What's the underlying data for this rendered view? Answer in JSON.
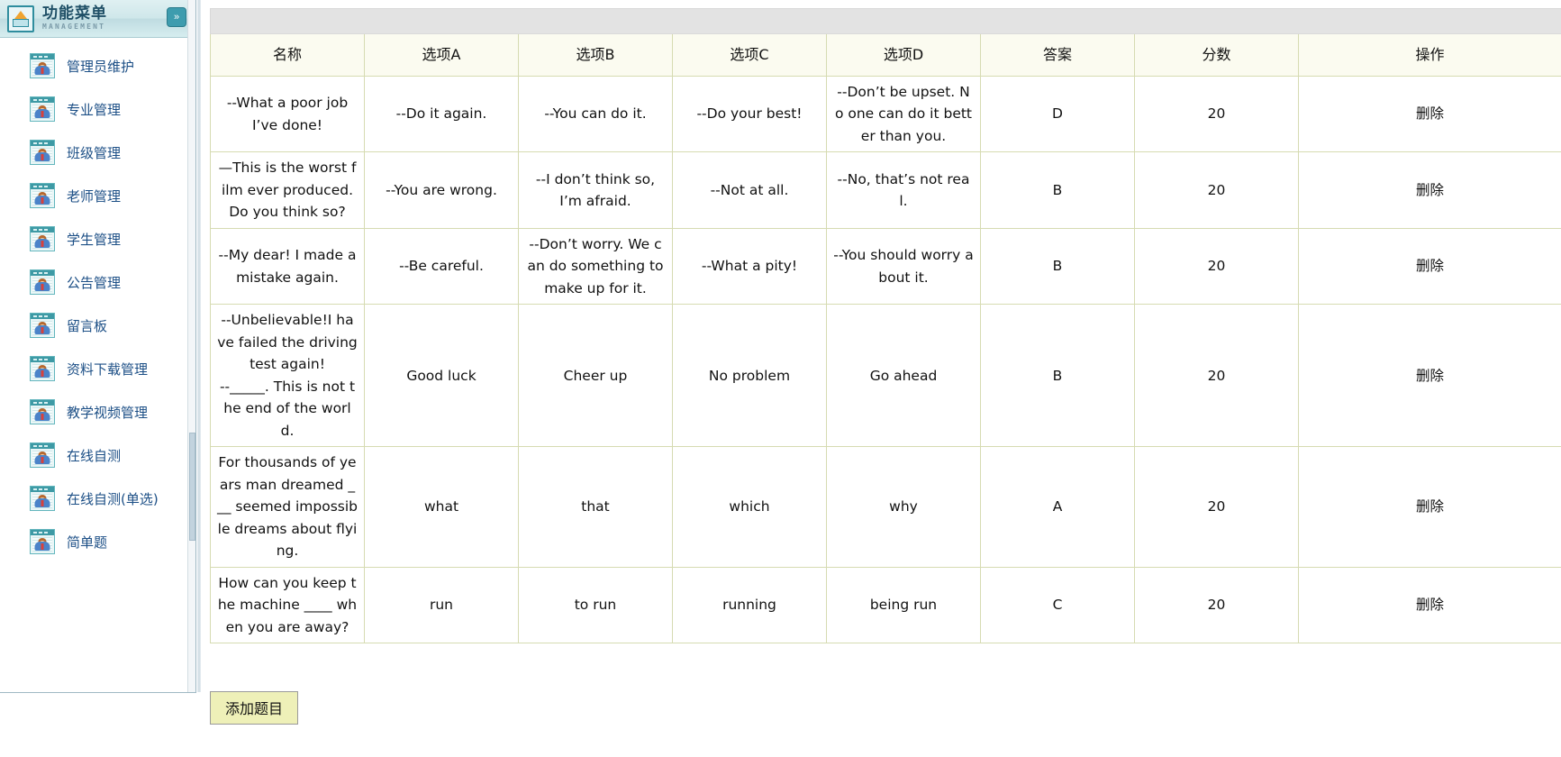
{
  "sidebar": {
    "title": "功能菜单",
    "subtitle": "MANAGEMENT",
    "collapse_label": "»",
    "items": [
      {
        "label": "管理员维护",
        "icon": "person-card-icon"
      },
      {
        "label": "专业管理",
        "icon": "person-card-icon"
      },
      {
        "label": "班级管理",
        "icon": "person-card-icon"
      },
      {
        "label": "老师管理",
        "icon": "person-card-icon"
      },
      {
        "label": "学生管理",
        "icon": "person-card-icon"
      },
      {
        "label": "公告管理",
        "icon": "person-card-icon"
      },
      {
        "label": "留言板",
        "icon": "person-card-icon"
      },
      {
        "label": "资料下载管理",
        "icon": "person-card-icon"
      },
      {
        "label": "教学视频管理",
        "icon": "person-card-icon"
      },
      {
        "label": "在线自测",
        "icon": "person-card-icon"
      },
      {
        "label": "在线自测(单选)",
        "icon": "person-card-icon"
      },
      {
        "label": "简单题",
        "icon": "person-card-icon"
      }
    ]
  },
  "main": {
    "add_button_label": "添加题目",
    "table": {
      "columns": [
        "名称",
        "选项A",
        "选项B",
        "选项C",
        "选项D",
        "答案",
        "分数",
        "操作"
      ],
      "rows": [
        {
          "name": "--What a poor job I’ve done!",
          "a": "--Do it again.",
          "b": "--You can do it.",
          "c": "--Do your best!",
          "d": "--Don’t be upset. No one can do it better than you.",
          "answer": "D",
          "score": "20",
          "op": "删除"
        },
        {
          "name": "—This is the worst film ever produced. Do you think so?",
          "a": "--You are wrong.",
          "b": "--I don’t think so, I’m afraid.",
          "c": "--Not at all.",
          "d": "--No, that’s not real.",
          "answer": "B",
          "score": "20",
          "op": "删除"
        },
        {
          "name": "--My dear! I made a mistake again.",
          "a": "--Be careful.",
          "b": "--Don’t worry. We can do something to make up for it.",
          "c": "--What a pity!",
          "d": "--You should worry about it.",
          "answer": "B",
          "score": "20",
          "op": "删除"
        },
        {
          "name": "--Unbelievable!I have failed the driving test again!\n--_____. This is not the end of the world.",
          "a": "Good luck",
          "b": "Cheer up",
          "c": "No problem",
          "d": "Go ahead",
          "answer": "B",
          "score": "20",
          "op": "删除"
        },
        {
          "name": "For thousands of years man dreamed ___ seemed impossible dreams about flying.",
          "a": "what",
          "b": "that",
          "c": "which",
          "d": "why",
          "answer": "A",
          "score": "20",
          "op": "删除"
        },
        {
          "name": "How can you keep the machine ____ when you are away?",
          "a": "run",
          "b": "to run",
          "c": "running",
          "d": "being run",
          "answer": "C",
          "score": "20",
          "op": "删除"
        }
      ]
    }
  },
  "colors": {
    "sidebar_header_accent": "#3e9cae",
    "menu_label": "#1c4f86",
    "table_border": "#d6dbb2",
    "table_header_bg": "#fbfbf0",
    "toolbar_bg": "#e3e3e3",
    "add_button_bg": "#eef0b8"
  }
}
